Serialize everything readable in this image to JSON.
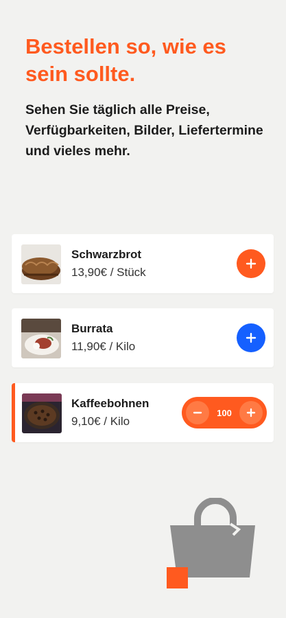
{
  "header": {
    "title": "Bestellen so, wie es sein sollte.",
    "subtitle": "Sehen Sie täglich alle Preise, Verfügbarkeiten, Bilder, Liefertermine und vieles mehr."
  },
  "products": [
    {
      "name": "Schwarzbrot",
      "price": "13,90€ / Stück",
      "thumb_icon": "bread-image",
      "action": "add",
      "button_color": "#ff5a1f"
    },
    {
      "name": "Burrata",
      "price": "11,90€ / Kilo",
      "thumb_icon": "burrata-dish-image",
      "action": "add",
      "button_color": "#1560ff"
    },
    {
      "name": "Kaffeebohnen",
      "price": "9,10€ / Kilo",
      "thumb_icon": "coffee-beans-image",
      "action": "stepper",
      "quantity": "100",
      "button_color": "#ff5a1f"
    }
  ],
  "illustration": {
    "icon": "shopping-bag-icon"
  },
  "colors": {
    "accent": "#ff5a1f",
    "blue": "#1560ff",
    "background": "#f2f2f0",
    "bag": "#8e8e8e"
  }
}
